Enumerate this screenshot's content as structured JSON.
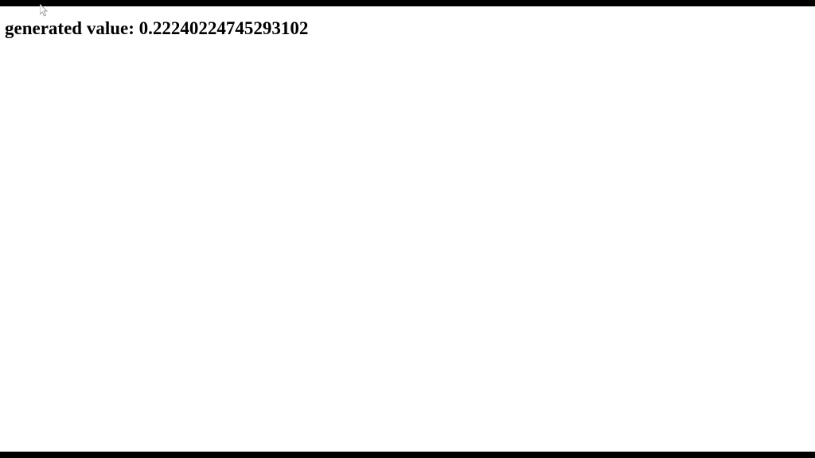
{
  "output": {
    "label": "generated value: ",
    "number": "0.22240224745293102"
  }
}
